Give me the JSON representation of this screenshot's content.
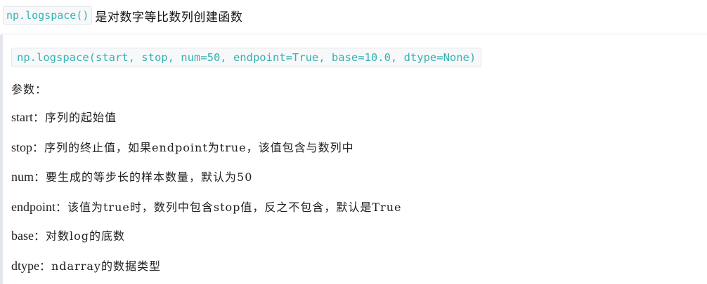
{
  "heading": {
    "code": "np.logspace()",
    "text": "是对数字等比数列创建函数"
  },
  "signature": {
    "code": "np.logspace(start, stop, num=50, endpoint=True, base=10.0, dtype=None)"
  },
  "params": {
    "title": "参数：",
    "items": [
      {
        "name": "start",
        "desc": "：序列的起始值"
      },
      {
        "name": "stop",
        "desc": "：序列的终止值，如果endpoint为true，该值包含与数列中"
      },
      {
        "name": "num",
        "desc": "：要生成的等步长的样本数量，默认为50"
      },
      {
        "name": "endpoint",
        "desc": "：该值为true时，数列中包含stop值，反之不包含，默认是True"
      },
      {
        "name": "base",
        "desc": "：对数log的底数"
      },
      {
        "name": "dtype",
        "desc": "：ndarray的数据类型"
      }
    ]
  }
}
